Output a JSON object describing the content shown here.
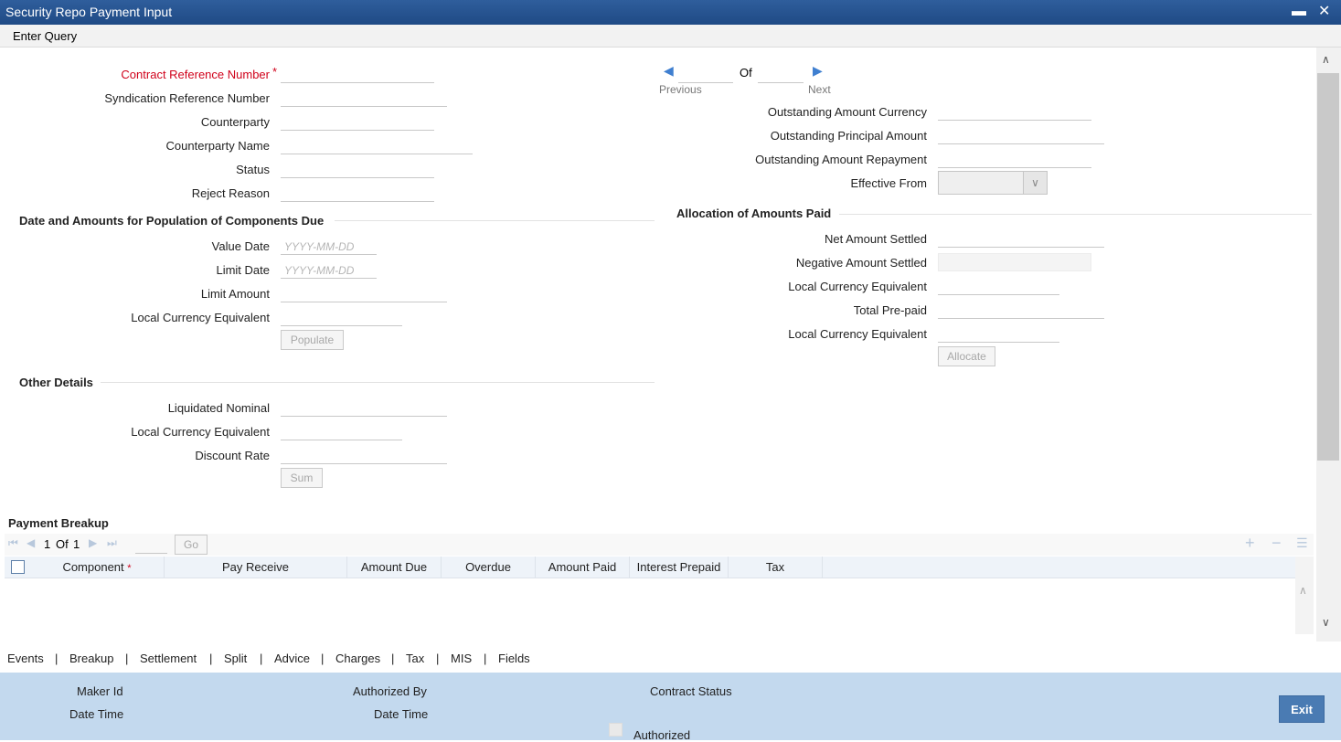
{
  "window": {
    "title": "Security Repo Payment Input"
  },
  "menu": {
    "enter_query": "Enter Query"
  },
  "header_fields": {
    "contract_ref": "Contract Reference Number",
    "required_mark": "*",
    "syndication_ref": "Syndication Reference Number",
    "counterparty": "Counterparty",
    "counterparty_name": "Counterparty Name",
    "status": "Status",
    "reject_reason": "Reject Reason"
  },
  "navigation": {
    "of": "Of",
    "previous": "Previous",
    "next": "Next"
  },
  "outstanding": {
    "currency": "Outstanding Amount Currency",
    "principal": "Outstanding Principal Amount",
    "repayment": "Outstanding Amount Repayment",
    "effective_from": "Effective From"
  },
  "components_due": {
    "title": "Date and Amounts for Population of Components Due",
    "value_date": "Value Date",
    "limit_date": "Limit Date",
    "date_placeholder": "YYYY-MM-DD",
    "limit_amount": "Limit Amount",
    "local_ccy_equiv": "Local Currency Equivalent",
    "populate": "Populate"
  },
  "allocation": {
    "title": "Allocation of Amounts Paid",
    "net_settled": "Net Amount Settled",
    "negative_settled": "Negative Amount Settled",
    "local_ccy_equiv_1": "Local Currency Equivalent",
    "total_prepaid": "Total Pre-paid",
    "local_ccy_equiv_2": "Local Currency Equivalent",
    "allocate": "Allocate"
  },
  "other_details": {
    "title": "Other Details",
    "liquidated_nominal": "Liquidated Nominal",
    "local_ccy_equiv": "Local Currency Equivalent",
    "discount_rate": "Discount Rate",
    "sum": "Sum"
  },
  "payment_breakup": {
    "title": "Payment Breakup",
    "page_current": "1",
    "page_of": "Of",
    "page_total": "1",
    "go": "Go",
    "columns": [
      "Component",
      "Pay Receive",
      "Amount Due",
      "Overdue",
      "Amount Paid",
      "Interest Prepaid",
      "Tax"
    ],
    "required_mark": "*"
  },
  "tabs": [
    "Events",
    "Breakup",
    "Settlement",
    "Split",
    "Advice",
    "Charges",
    "Tax",
    "MIS",
    "Fields"
  ],
  "tab_separator": "|",
  "audit": {
    "maker_id": "Maker Id",
    "date_time_1": "Date Time",
    "authorized_by": "Authorized By",
    "date_time_2": "Date Time",
    "contract_status": "Contract Status",
    "authorized": "Authorized",
    "exit": "Exit"
  },
  "colors": {
    "title_bar": "#1f4a85",
    "required": "#d0021b",
    "footer": "#c3d9ee",
    "exit_button": "#4a7bb3"
  }
}
